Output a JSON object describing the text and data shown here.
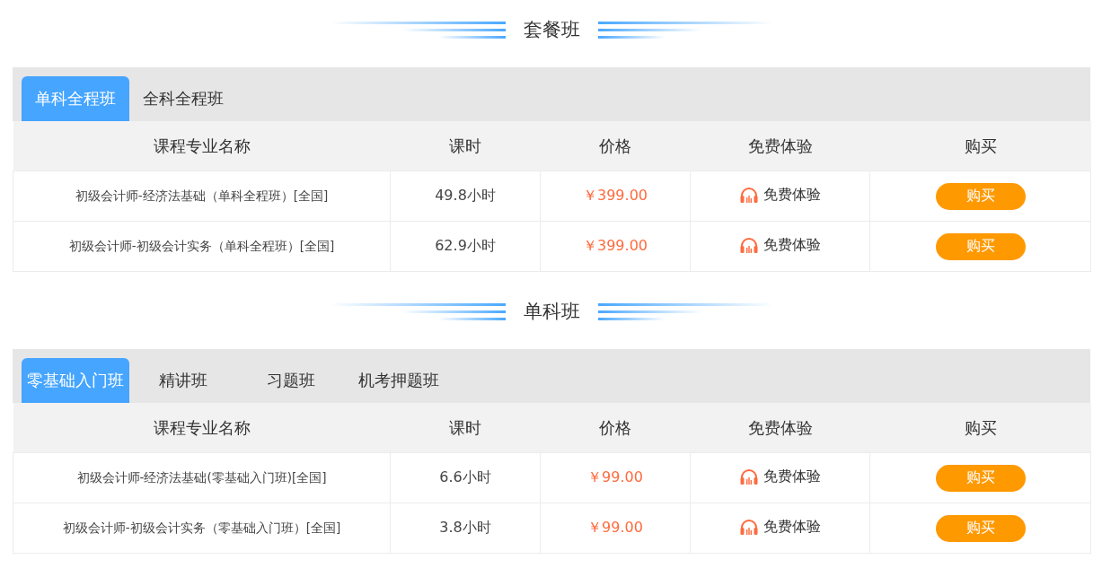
{
  "sections": [
    {
      "title": "套餐班",
      "tabs": [
        {
          "label": "单科全程班",
          "selected": true
        },
        {
          "label": "全科全程班",
          "selected": false
        }
      ],
      "columns": [
        "课程专业名称",
        "课时",
        "价格",
        "免费体验",
        "购买"
      ],
      "rows": [
        {
          "name": "初级会计师-经济法基础（单科全程班）[全国]",
          "hours": "49.8小时",
          "price": "￥399.00",
          "trial": "免费体验",
          "buy": "购买"
        },
        {
          "name": "初级会计师-初级会计实务（单科全程班）[全国]",
          "hours": "62.9小时",
          "price": "￥399.00",
          "trial": "免费体验",
          "buy": "购买"
        }
      ]
    },
    {
      "title": "单科班",
      "tabs": [
        {
          "label": "零基础入门班",
          "selected": true
        },
        {
          "label": "精讲班",
          "selected": false
        },
        {
          "label": "习题班",
          "selected": false
        },
        {
          "label": "机考押题班",
          "selected": false
        }
      ],
      "columns": [
        "课程专业名称",
        "课时",
        "价格",
        "免费体验",
        "购买"
      ],
      "rows": [
        {
          "name": "初级会计师-经济法基础(零基础入门班)[全国]",
          "hours": "6.6小时",
          "price": "￥99.00",
          "trial": "免费体验",
          "buy": "购买"
        },
        {
          "name": "初级会计师-初级会计实务（零基础入门班）[全国]",
          "hours": "3.8小时",
          "price": "￥99.00",
          "trial": "免费体验",
          "buy": "购买"
        }
      ]
    }
  ]
}
